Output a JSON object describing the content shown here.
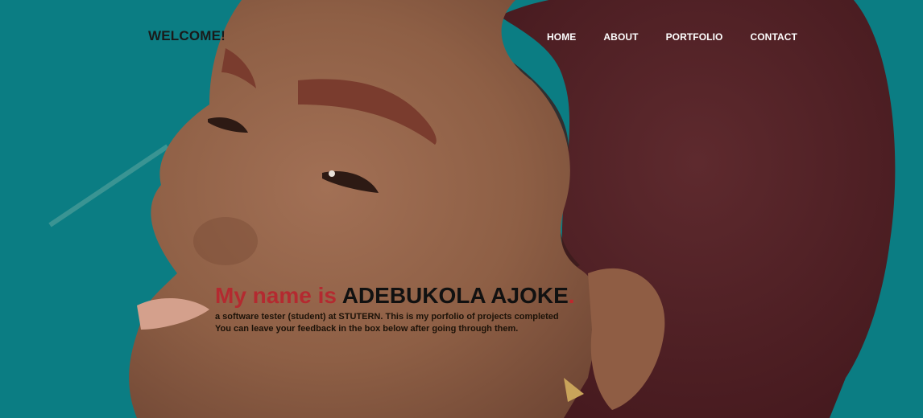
{
  "header": {
    "brand": "WELCOME!",
    "nav": [
      {
        "label": "HOME"
      },
      {
        "label": "ABOUT"
      },
      {
        "label": "PORTFOLIO"
      },
      {
        "label": "CONTACT"
      }
    ]
  },
  "hero": {
    "headline_lead": "My name is",
    "headline_name": "ADEBUKOLA AJOKE",
    "headline_end": ".",
    "intro_line1": "a software tester (student) at STUTERN. This is my porfolio of projects completed",
    "intro_line2": "You can leave your feedback in the box below after going through them."
  },
  "colors": {
    "background": "#0b7d83",
    "accent": "#b42a30",
    "nav_text": "#ffffff"
  }
}
